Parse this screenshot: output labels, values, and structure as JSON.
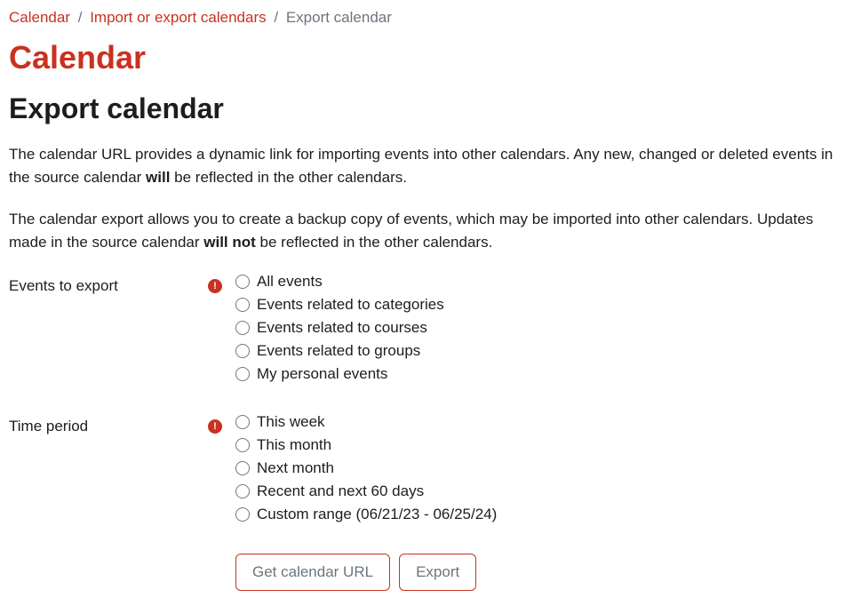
{
  "breadcrumb": {
    "item1": "Calendar",
    "item2": "Import or export calendars",
    "item3": "Export calendar"
  },
  "page_title": "Calendar",
  "section_title": "Export calendar",
  "desc1": {
    "a": "The calendar URL provides a dynamic link for importing events into other calendars. Any new, changed or deleted events in the source calendar ",
    "b": "will",
    "c": " be reflected in the other calendars."
  },
  "desc2": {
    "a": "The calendar export allows you to create a backup copy of events, which may be imported into other calendars. Updates made in the source calendar ",
    "b": "will not",
    "c": " be reflected in the other calendars."
  },
  "form": {
    "events": {
      "label": "Events to export",
      "options": [
        "All events",
        "Events related to categories",
        "Events related to courses",
        "Events related to groups",
        "My personal events"
      ]
    },
    "period": {
      "label": "Time period",
      "options": [
        "This week",
        "This month",
        "Next month",
        "Recent and next 60 days",
        "Custom range (06/21/23 - 06/25/24)"
      ]
    }
  },
  "buttons": {
    "url": "Get calendar URL",
    "export": "Export"
  }
}
